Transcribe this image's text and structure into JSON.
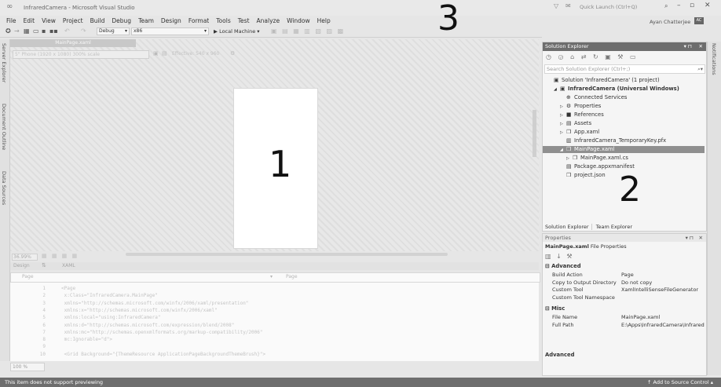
{
  "window": {
    "title": "InfraredCamera - Microsoft Visual Studio",
    "quick_launch_placeholder": "Quick Launch (Ctrl+Q)",
    "user_name": "Ayan Chatterjee",
    "user_initials": "AC"
  },
  "menu": [
    "File",
    "Edit",
    "View",
    "Project",
    "Build",
    "Debug",
    "Team",
    "Design",
    "Format",
    "Tools",
    "Test",
    "Analyze",
    "Window",
    "Help"
  ],
  "toolbar": {
    "config": "Debug",
    "platform": "x86",
    "run_target": "▶ Local Machine ▾"
  },
  "left_tabs": [
    "Server Explorer",
    "Document Outline",
    "Data Sources"
  ],
  "designer": {
    "doc_tab": "MainPage.xaml",
    "device": "5\" Phone (1920 x 1080) 300% scale",
    "effective": "Effective: 540 x 960",
    "zoom": "36.99%",
    "split_tabs": [
      "Design",
      "XAML"
    ],
    "nav_left": "Page",
    "nav_right": "Page",
    "code_lines": [
      {
        "num": "1",
        "text": "<Page"
      },
      {
        "num": "2",
        "text": "    x:Class=\"InfraredCamera.MainPage\""
      },
      {
        "num": "3",
        "text": "    xmlns=\"http://schemas.microsoft.com/winfx/2006/xaml/presentation\""
      },
      {
        "num": "4",
        "text": "    xmlns:x=\"http://schemas.microsoft.com/winfx/2006/xaml\""
      },
      {
        "num": "5",
        "text": "    xmlns:local=\"using:InfraredCamera\""
      },
      {
        "num": "6",
        "text": "    xmlns:d=\"http://schemas.microsoft.com/expression/blend/2008\""
      },
      {
        "num": "7",
        "text": "    xmlns:mc=\"http://schemas.openxmlformats.org/markup-compatibility/2006\""
      },
      {
        "num": "8",
        "text": "    mc:Ignorable=\"d\">"
      },
      {
        "num": "9",
        "text": ""
      },
      {
        "num": "10",
        "text": "    <Grid Background=\"{ThemeResource ApplicationPageBackgroundThemeBrush}\">"
      }
    ],
    "bottom_zoom": "100 %"
  },
  "annotations": {
    "one": "1",
    "two": "2",
    "three": "3"
  },
  "solution_explorer": {
    "title": "Solution Explorer",
    "search_placeholder": "Search Solution Explorer (Ctrl+;)",
    "items": [
      {
        "label": "Solution 'InfraredCamera' (1 project)",
        "indent": 0,
        "arrow": "",
        "icon": "▣",
        "bold": false,
        "selected": false
      },
      {
        "label": "InfraredCamera (Universal Windows)",
        "indent": 1,
        "arrow": "◢",
        "icon": "▣",
        "bold": true,
        "selected": false
      },
      {
        "label": "Connected Services",
        "indent": 2,
        "arrow": "",
        "icon": "⊕",
        "bold": false,
        "selected": false
      },
      {
        "label": "Properties",
        "indent": 2,
        "arrow": "▷",
        "icon": "⚙",
        "bold": false,
        "selected": false
      },
      {
        "label": "References",
        "indent": 2,
        "arrow": "▷",
        "icon": "■",
        "bold": false,
        "selected": false
      },
      {
        "label": "Assets",
        "indent": 2,
        "arrow": "▷",
        "icon": "▤",
        "bold": false,
        "selected": false
      },
      {
        "label": "App.xaml",
        "indent": 2,
        "arrow": "▷",
        "icon": "❒",
        "bold": false,
        "selected": false
      },
      {
        "label": "InfraredCamera_TemporaryKey.pfx",
        "indent": 2,
        "arrow": "",
        "icon": "▥",
        "bold": false,
        "selected": false
      },
      {
        "label": "MainPage.xaml",
        "indent": 2,
        "arrow": "◢",
        "icon": "❒",
        "bold": false,
        "selected": true
      },
      {
        "label": "MainPage.xaml.cs",
        "indent": 3,
        "arrow": "▷",
        "icon": "❒",
        "bold": false,
        "selected": false
      },
      {
        "label": "Package.appxmanifest",
        "indent": 2,
        "arrow": "",
        "icon": "▤",
        "bold": false,
        "selected": false
      },
      {
        "label": "project.json",
        "indent": 2,
        "arrow": "",
        "icon": "❒",
        "bold": false,
        "selected": false
      }
    ],
    "tabs": [
      "Solution Explorer",
      "Team Explorer"
    ]
  },
  "properties": {
    "title": "Properties",
    "subtitle_file": "MainPage.xaml",
    "subtitle_rest": " File Properties",
    "advanced_header": "Advanced",
    "rows_advanced": [
      {
        "k": "Build Action",
        "v": "Page"
      },
      {
        "k": "Copy to Output Directory",
        "v": "Do not copy"
      },
      {
        "k": "Custom Tool",
        "v": "XamlIntelliSenseFileGenerator"
      },
      {
        "k": "Custom Tool Namespace",
        "v": ""
      }
    ],
    "misc_header": "Misc",
    "rows_misc": [
      {
        "k": "File Name",
        "v": "MainPage.xaml"
      },
      {
        "k": "Full Path",
        "v": "E:\\Apps\\InfraredCamera\\Infrared"
      }
    ],
    "footer": "Advanced"
  },
  "right_strip": "Notifications",
  "status": {
    "left": "This item does not support previewing",
    "right": "↑ Add to Source Control ▴"
  }
}
